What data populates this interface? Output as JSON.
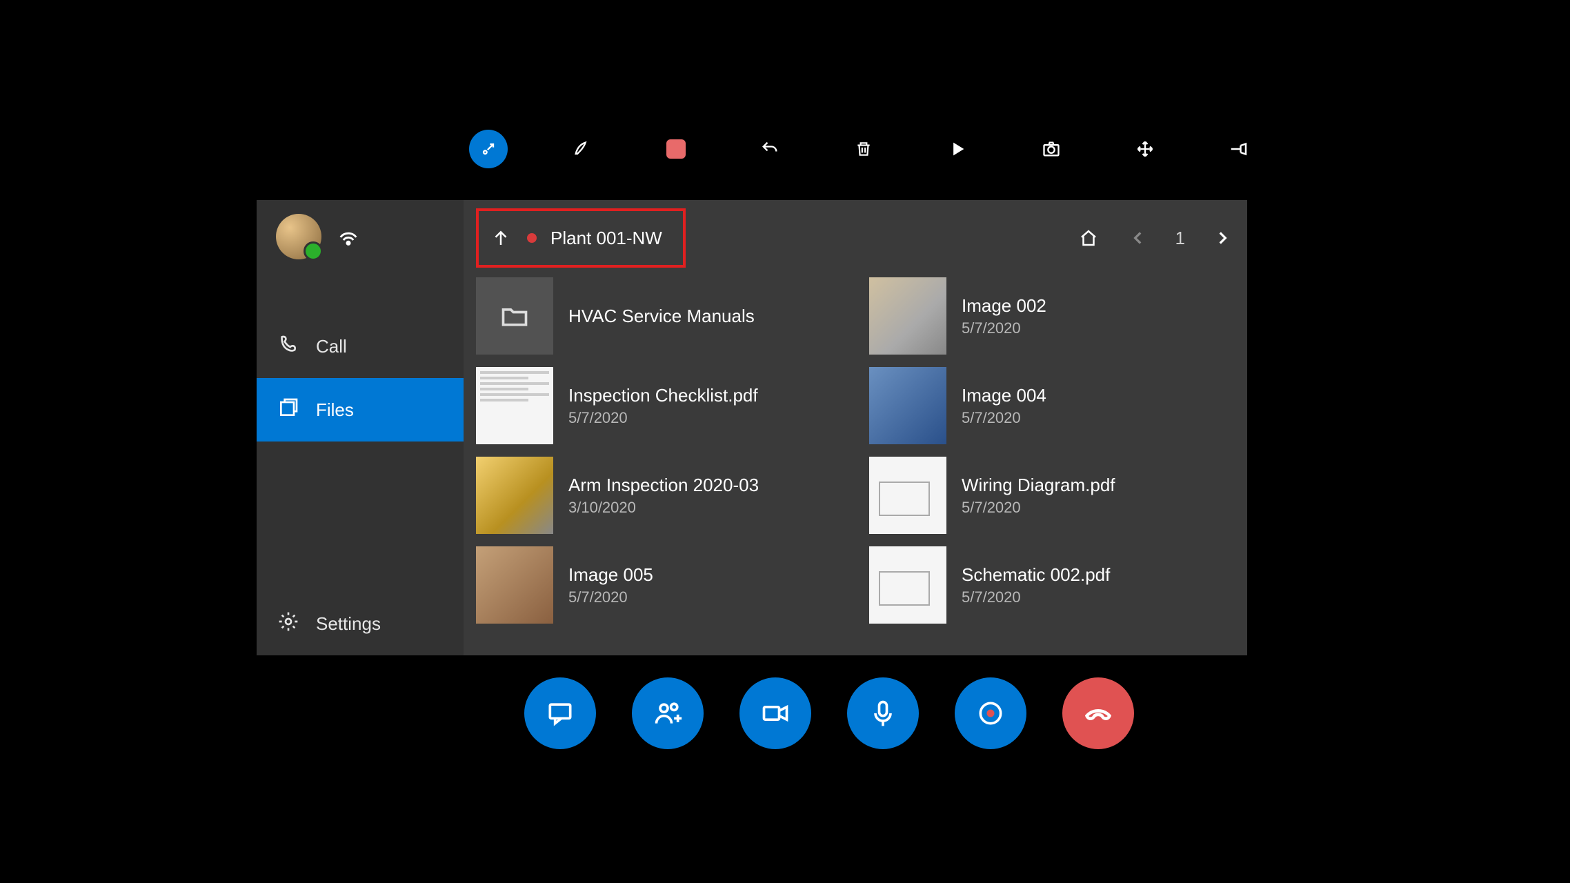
{
  "breadcrumb": {
    "label": "Plant 001-NW"
  },
  "header": {
    "page": "1"
  },
  "sidebar": {
    "items": [
      {
        "label": "Call"
      },
      {
        "label": "Files"
      },
      {
        "label": "Settings"
      }
    ]
  },
  "files": {
    "left": [
      {
        "name": "HVAC Service Manuals",
        "date": ""
      },
      {
        "name": "Inspection Checklist.pdf",
        "date": "5/7/2020"
      },
      {
        "name": "Arm Inspection 2020-03",
        "date": "3/10/2020"
      },
      {
        "name": "Image 005",
        "date": "5/7/2020"
      }
    ],
    "right": [
      {
        "name": "Image 002",
        "date": "5/7/2020"
      },
      {
        "name": "Image 004",
        "date": "5/7/2020"
      },
      {
        "name": "Wiring Diagram.pdf",
        "date": "5/7/2020"
      },
      {
        "name": "Schematic 002.pdf",
        "date": "5/7/2020"
      }
    ]
  }
}
